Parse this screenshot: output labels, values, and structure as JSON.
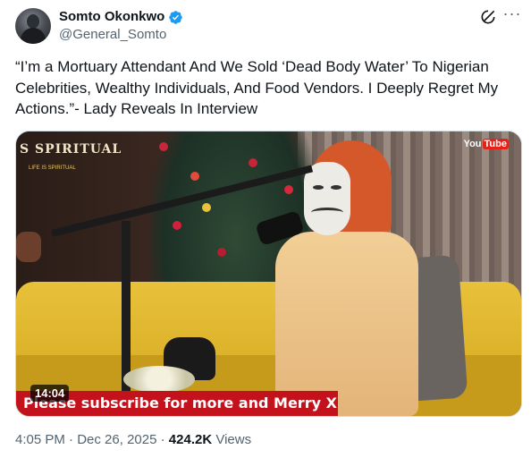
{
  "author": {
    "name": "Somto Okonkwo",
    "handle": "@General_Somto",
    "verified_color": "#1d9bf0"
  },
  "header": {
    "grok_icon": "grok-icon",
    "more_label": "···"
  },
  "tweet": {
    "text": "“I’m a Mortuary Attendant And We Sold ‘Dead Body Water’ To Nigerian Celebrities, Wealthy Individuals, And Food Vendors. I Deeply Regret My Actions.”- Lady Reveals In Interview"
  },
  "media": {
    "duration": "14:04",
    "banner_text": "Please subscribe for more and Merry Xmas",
    "watermark_left": "S SPIRITUAL",
    "watermark_left_sub": "LIFE IS SPIRITUAL",
    "youtube_label_you": "You",
    "youtube_label_tube": "Tube"
  },
  "meta": {
    "time": "4:05 PM",
    "sep1": " · ",
    "date": "Dec 26, 2025",
    "sep2": " · ",
    "views_count": "424.2K",
    "views_label": " Views"
  }
}
